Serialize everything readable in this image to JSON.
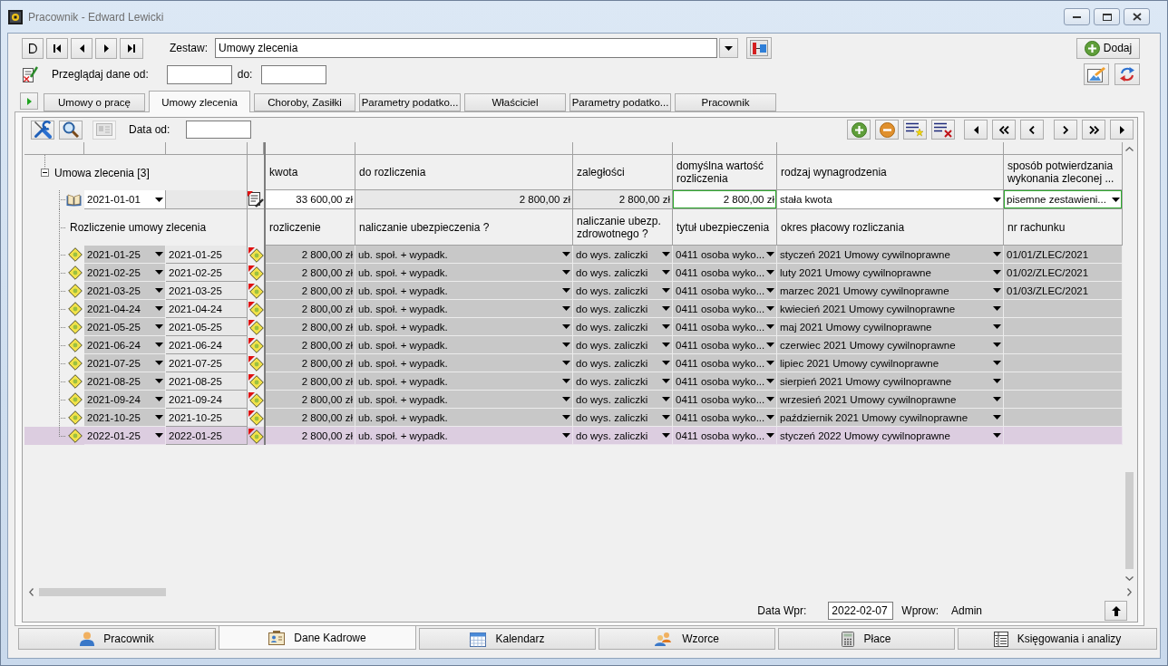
{
  "window": {
    "title": "Pracownik - Edward Lewicki"
  },
  "header": {
    "set_label": "Zestaw:",
    "set_value": "Umowy zlecenia",
    "add_button": "Dodaj",
    "browse_label": "Przeglądaj dane od:",
    "to_label": "do:"
  },
  "tabs": [
    {
      "label": "Umowy o pracę",
      "selected": false
    },
    {
      "label": "Umowy zlecenia",
      "selected": true
    },
    {
      "label": "Choroby, Zasiłki",
      "selected": false
    },
    {
      "label": "Parametry podatko...",
      "selected": false
    },
    {
      "label": "Właściciel",
      "selected": false
    },
    {
      "label": "Parametry podatko...",
      "selected": false
    },
    {
      "label": "Pracownik",
      "selected": false
    }
  ],
  "panel_toolbar": {
    "date_label": "Data od:",
    "card_button": {
      "disabled": true
    }
  },
  "grid": {
    "group": {
      "label": "Umowa zlecenia [3]",
      "expanded": true,
      "columns": [
        "kwota",
        "do rozliczenia",
        "zaległości",
        "domyślna wartość rozliczenia",
        "rodzaj wynagrodzenia",
        "sposób potwierdzania wykonania zleconej ..."
      ]
    },
    "contract": {
      "date": "2021-01-01",
      "cells": [
        {
          "kind": "amount",
          "value": "33 600,00 zł",
          "readonly": false,
          "highlighted": false
        },
        {
          "kind": "amount",
          "value": "2 800,00 zł",
          "readonly": true,
          "highlighted": false
        },
        {
          "kind": "amount",
          "value": "2 800,00 zł",
          "readonly": true,
          "highlighted": false
        },
        {
          "kind": "amount",
          "value": "2 800,00 zł",
          "readonly": false,
          "highlighted": true
        },
        {
          "kind": "dropdown",
          "value": "stała kwota",
          "readonly": false,
          "highlighted": false
        },
        {
          "kind": "dropdown",
          "value": "pisemne zestawieni...",
          "readonly": false,
          "highlighted": true
        }
      ]
    },
    "settlement_header": {
      "label": "Rozliczenie umowy zlecenia",
      "columns": [
        "rozliczenie",
        "naliczanie ubezpieczenia ?",
        "naliczanie ubezp. zdrowotnego ?",
        "tytuł ubezpieczenia",
        "okres płacowy rozliczania",
        "nr rachunku"
      ]
    },
    "settlements": [
      {
        "date": "2021-01-25",
        "payment_date": "2021-01-25",
        "amount": "2 800,00 zł",
        "social_insurance": "ub. społ. + wypadk.",
        "health_insurance": "do wys. zaliczki",
        "insurance_title": "0411 osoba wyko...",
        "payroll_period": "styczeń 2021 Umowy cywilnoprawne",
        "invoice_number": "01/01/ZLEC/2021",
        "selected": false
      },
      {
        "date": "2021-02-25",
        "payment_date": "2021-02-25",
        "amount": "2 800,00 zł",
        "social_insurance": "ub. społ. + wypadk.",
        "health_insurance": "do wys. zaliczki",
        "insurance_title": "0411 osoba wyko...",
        "payroll_period": "luty 2021 Umowy cywilnoprawne",
        "invoice_number": "01/02/ZLEC/2021",
        "selected": false
      },
      {
        "date": "2021-03-25",
        "payment_date": "2021-03-25",
        "amount": "2 800,00 zł",
        "social_insurance": "ub. społ. + wypadk.",
        "health_insurance": "do wys. zaliczki",
        "insurance_title": "0411 osoba wyko...",
        "payroll_period": "marzec 2021 Umowy cywilnoprawne",
        "invoice_number": "01/03/ZLEC/2021",
        "selected": false
      },
      {
        "date": "2021-04-24",
        "payment_date": "2021-04-24",
        "amount": "2 800,00 zł",
        "social_insurance": "ub. społ. + wypadk.",
        "health_insurance": "do wys. zaliczki",
        "insurance_title": "0411 osoba wyko...",
        "payroll_period": "kwiecień 2021 Umowy cywilnoprawne",
        "selected": false
      },
      {
        "date": "2021-05-25",
        "payment_date": "2021-05-25",
        "amount": "2 800,00 zł",
        "social_insurance": "ub. społ. + wypadk.",
        "health_insurance": "do wys. zaliczki",
        "insurance_title": "0411 osoba wyko...",
        "payroll_period": "maj 2021 Umowy cywilnoprawne",
        "selected": false
      },
      {
        "date": "2021-06-24",
        "payment_date": "2021-06-24",
        "amount": "2 800,00 zł",
        "social_insurance": "ub. społ. + wypadk.",
        "health_insurance": "do wys. zaliczki",
        "insurance_title": "0411 osoba wyko...",
        "payroll_period": "czerwiec 2021 Umowy cywilnoprawne",
        "selected": false
      },
      {
        "date": "2021-07-25",
        "payment_date": "2021-07-25",
        "amount": "2 800,00 zł",
        "social_insurance": "ub. społ. + wypadk.",
        "health_insurance": "do wys. zaliczki",
        "insurance_title": "0411 osoba wyko...",
        "payroll_period": "lipiec 2021 Umowy cywilnoprawne",
        "selected": false
      },
      {
        "date": "2021-08-25",
        "payment_date": "2021-08-25",
        "amount": "2 800,00 zł",
        "social_insurance": "ub. społ. + wypadk.",
        "health_insurance": "do wys. zaliczki",
        "insurance_title": "0411 osoba wyko...",
        "payroll_period": "sierpień 2021 Umowy cywilnoprawne",
        "selected": false
      },
      {
        "date": "2021-09-24",
        "payment_date": "2021-09-24",
        "amount": "2 800,00 zł",
        "social_insurance": "ub. społ. + wypadk.",
        "health_insurance": "do wys. zaliczki",
        "insurance_title": "0411 osoba wyko...",
        "payroll_period": "wrzesień 2021 Umowy cywilnoprawne",
        "selected": false
      },
      {
        "date": "2021-10-25",
        "payment_date": "2021-10-25",
        "amount": "2 800,00 zł",
        "social_insurance": "ub. społ. + wypadk.",
        "health_insurance": "do wys. zaliczki",
        "insurance_title": "0411 osoba wyko...",
        "payroll_period": "październik 2021 Umowy cywilnoprawne",
        "selected": false
      },
      {
        "date": "2022-01-25",
        "payment_date": "2022-01-25",
        "amount": "2 800,00 zł",
        "social_insurance": "ub. społ. + wypadk.",
        "health_insurance": "do wys. zaliczki",
        "insurance_title": "0411 osoba wyko...",
        "payroll_period": "styczeń 2022 Umowy cywilnoprawne",
        "selected": true
      }
    ]
  },
  "footer": {
    "entered_label": "Data Wpr:",
    "entered_date": "2022-02-07",
    "entered_by_label": "Wprow:",
    "entered_by": "Admin"
  },
  "bottom_tabs": [
    {
      "label": "Pracownik",
      "selected": false
    },
    {
      "label": "Dane Kadrowe",
      "selected": true
    },
    {
      "label": "Kalendarz",
      "selected": false
    },
    {
      "label": "Wzorce",
      "selected": false
    },
    {
      "label": "Płace",
      "selected": false
    },
    {
      "label": "Księgowania i analizy",
      "selected": false
    }
  ]
}
